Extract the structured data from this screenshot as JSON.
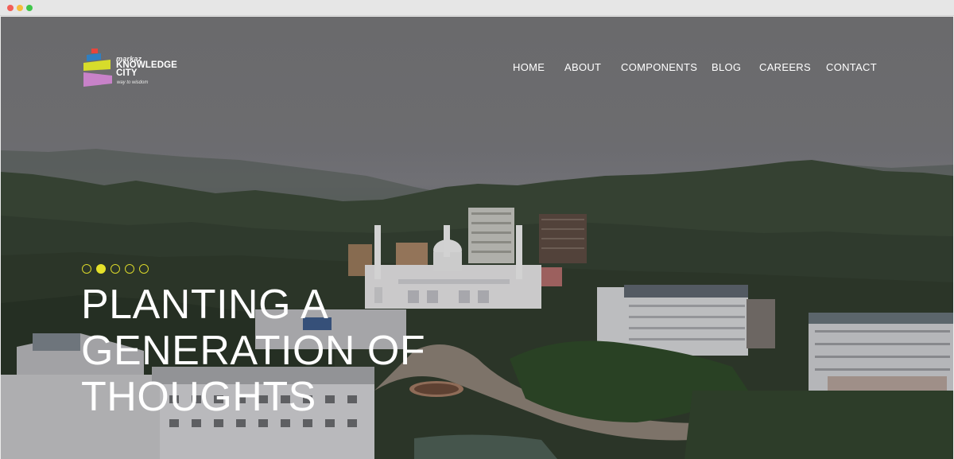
{
  "window": {
    "traffic_lights": [
      "close",
      "minimize",
      "maximize"
    ]
  },
  "brand": {
    "small": "markaz",
    "line1": "KNOWLEDGE",
    "line2": "CITY",
    "tagline": "way to wisdom",
    "colors": [
      "#e8453c",
      "#2f7fc1",
      "#d7dc2b",
      "#c882c9"
    ]
  },
  "nav": {
    "items": [
      {
        "label": "HOME"
      },
      {
        "label": "ABOUT"
      },
      {
        "label": "COMPONENTS"
      },
      {
        "label": "BLOG"
      },
      {
        "label": "CAREERS"
      },
      {
        "label": "CONTACT"
      }
    ]
  },
  "slider": {
    "count": 5,
    "active_index": 1,
    "accent": "#e5e12a"
  },
  "hero": {
    "headline_lines": [
      "PLANTING A",
      "GENERATION OF",
      "THOUGHTS"
    ]
  }
}
